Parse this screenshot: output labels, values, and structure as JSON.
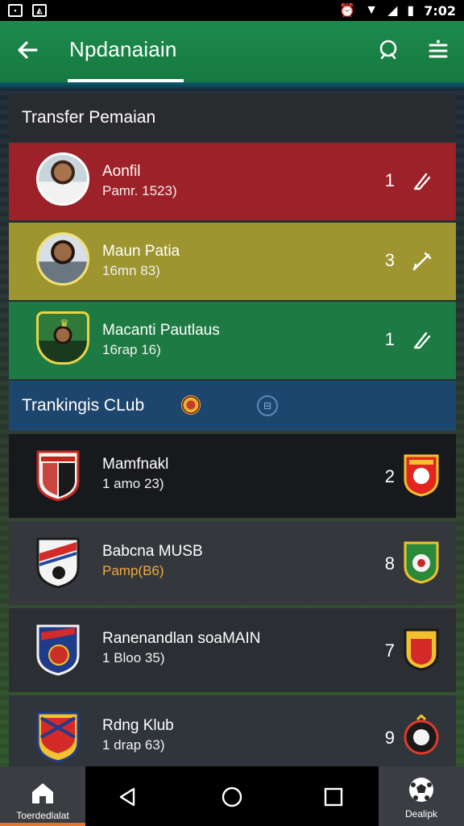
{
  "status_bar": {
    "time": "7:02"
  },
  "app_bar": {
    "title": "Npdanaiain"
  },
  "transfer_section": {
    "title": "Transfer Pemaian",
    "players": [
      {
        "name": "Aonfil",
        "sub": "Pamr. 1523)",
        "number": "1"
      },
      {
        "name": "Maun Patia",
        "sub": "16mn 83)",
        "number": "3"
      },
      {
        "name": "Macanti Pautlaus",
        "sub": "16rap 16)",
        "number": "1"
      }
    ]
  },
  "club_section": {
    "title": "Trankingis CLub",
    "clubs": [
      {
        "name": "Mamfnakl",
        "sub": "1 amo 23)",
        "number": "2"
      },
      {
        "name": "Babcna MUSB",
        "sub": "Pamp(B6)",
        "number": "8"
      },
      {
        "name": "Ranenandlan soaMAIN",
        "sub": "1 Bloo 35)",
        "number": "7"
      },
      {
        "name": "Rdng Klub",
        "sub": "1 drap 63)",
        "number": "9"
      }
    ]
  },
  "bottom_nav": {
    "left_label": "Toerdedlalat",
    "right_label": "Dealipk"
  },
  "icons": {
    "back": "arrow-left-icon",
    "search": "search-icon",
    "menu": "menu-icon",
    "edit": "pencil-icon",
    "home": "home-icon",
    "ball": "soccer-ball-icon"
  },
  "colors": {
    "app_bar": "#1e8a4c",
    "row_red": "#9c2128",
    "row_yellow": "#9e9531",
    "row_green": "#1d7a43",
    "club_header": "#1c466d",
    "nav_accent": "#e2752d"
  }
}
